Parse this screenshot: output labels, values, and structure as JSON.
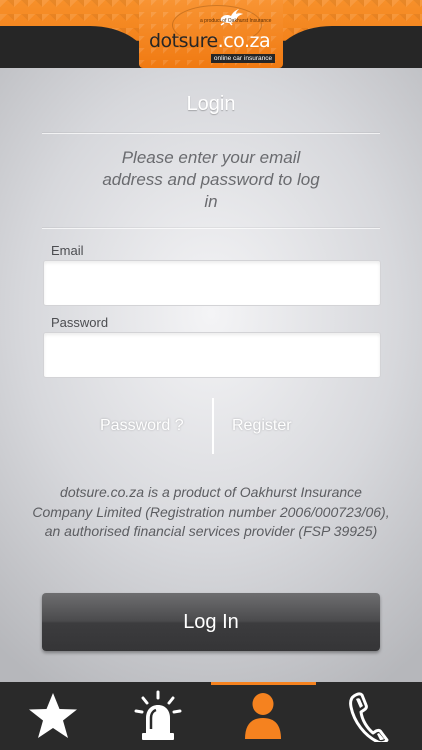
{
  "header": {
    "logo_main": "dotsure",
    "logo_domain": ".co.za",
    "logo_tagline": "a product of Oakhurst Insurance",
    "logo_sub": "online car insurance",
    "accent_color": "#f5821f"
  },
  "login": {
    "title": "Login",
    "instructions": "Please enter your email address and password to log in",
    "email_label": "Email",
    "email_value": "",
    "password_label": "Password",
    "password_value": "",
    "forgot_password_link": "Password ?",
    "register_link": "Register",
    "disclaimer": "dotsure.co.za is a product of Oakhurst Insurance Company Limited (Registration number 2006/000723/06), an authorised financial services provider (FSP 39925)",
    "login_button": "Log In"
  },
  "tabbar": {
    "active_index": 2,
    "tabs": [
      {
        "icon": "star-icon"
      },
      {
        "icon": "emergency-siren-icon"
      },
      {
        "icon": "user-icon"
      },
      {
        "icon": "phone-icon"
      }
    ],
    "active_color": "#f5821f"
  }
}
